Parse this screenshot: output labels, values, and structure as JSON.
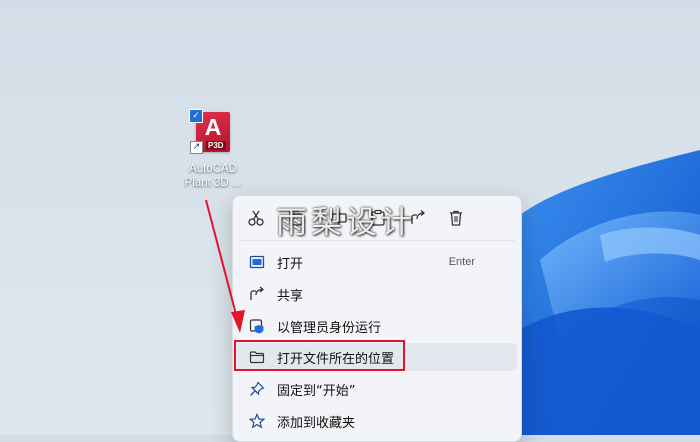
{
  "desktop": {
    "icon": {
      "letter": "A",
      "badge": "P3D",
      "label_line1": "AutoCAD",
      "label_line2": "Plant 3D ..."
    }
  },
  "context_menu": {
    "toolbar": [
      "cut-icon",
      "copy-icon",
      "rename-icon",
      "share-icon",
      "delete-icon"
    ],
    "items": [
      {
        "label": "打开",
        "shortcut": "Enter",
        "icon": "open-app-icon"
      },
      {
        "label": "共享",
        "icon": "share-icon"
      },
      {
        "label": "以管理员身份运行",
        "icon": "admin-shield-icon"
      },
      {
        "label": "打开文件所在的位置",
        "icon": "folder-icon",
        "highlighted": true
      },
      {
        "label": "固定到“开始”",
        "icon": "pin-icon"
      },
      {
        "label": "添加到收藏夹",
        "icon": "star-icon"
      }
    ]
  },
  "watermark": "雨梨设计",
  "colors": {
    "accent_blue": "#1f6fd6",
    "highlight_red": "#e4122a",
    "brand_red": "#c8102e"
  }
}
